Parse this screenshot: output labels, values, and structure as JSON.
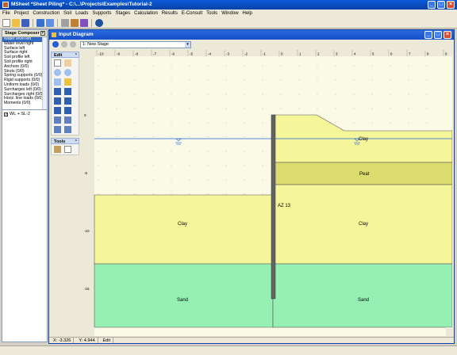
{
  "app": {
    "title": "MSheet *Sheet Piling* - C:\\...\\Projects\\Examples\\Tutorial-2",
    "window_buttons": [
      "_",
      "□",
      "×"
    ]
  },
  "menu": [
    "File",
    "Project",
    "Construction",
    "Soil",
    "Loads",
    "Supports",
    "Stages",
    "Calculation",
    "Results",
    "E-Consult",
    "Tools",
    "Window",
    "Help"
  ],
  "stage_composer": {
    "title": "Stage Composer",
    "items": [
      "Water level left",
      "Water level right",
      "Surface left",
      "Surface right",
      "Soil profile left",
      "Soil profile right",
      "Anchors (0/0)",
      "Struts (0/0)",
      "Spring supports (0/0)",
      "Rigid supports (0/0)",
      "Uniform loads (0/0)",
      "Surcharges left (0/0)",
      "Surcharges right (0/0)",
      "Horiz. line loads (0/0)",
      "Moments (0/0)"
    ],
    "selected_index": 0,
    "tree_item": "WL + SL-2"
  },
  "input_diagram": {
    "title": "Input Diagram",
    "stage_value": "1: New Stage",
    "tool_groups": [
      {
        "title": "Edit",
        "icons": [
          "select-icon",
          "pan-icon",
          "zoom-in-icon",
          "zoom-out-icon",
          "zoom-limits-icon",
          "zoom-rect-icon",
          "add-anchor-icon",
          "add-strut-icon",
          "add-spring-icon",
          "add-load-icon",
          "add-surcharge-icon",
          "add-moment-icon",
          "add-level-icon",
          "delete-icon",
          "undo-icon",
          "redo-icon"
        ]
      },
      {
        "title": "Tools",
        "icons": [
          "ruler-icon",
          "info-icon"
        ]
      }
    ],
    "h_ruler": [
      "-10",
      "-9",
      "-8",
      "-7",
      "-6",
      "-5",
      "-4",
      "-3",
      "-2",
      "-1",
      "0",
      "1",
      "2",
      "3",
      "4",
      "5",
      "6",
      "7",
      "8",
      "9"
    ],
    "v_ruler": [
      "0",
      "-5",
      "-10",
      "-15"
    ],
    "labels": {
      "sheet": "AZ 13",
      "clay_left": "Clay",
      "clay_right": "Clay",
      "clay_right_top": "Clay",
      "peat_right": "Peat",
      "sand_left": "Sand",
      "sand_right": "Sand"
    },
    "colors": {
      "background": "#fafae6",
      "clay": "#f5f59a",
      "peat": "#dcdc6e",
      "sand": "#96f0b4",
      "water_line": "#1e64dc",
      "sheet": "#646464"
    }
  },
  "status": {
    "x": "X: -3.326",
    "y": "Y: 4.944",
    "mode": "Edit"
  }
}
